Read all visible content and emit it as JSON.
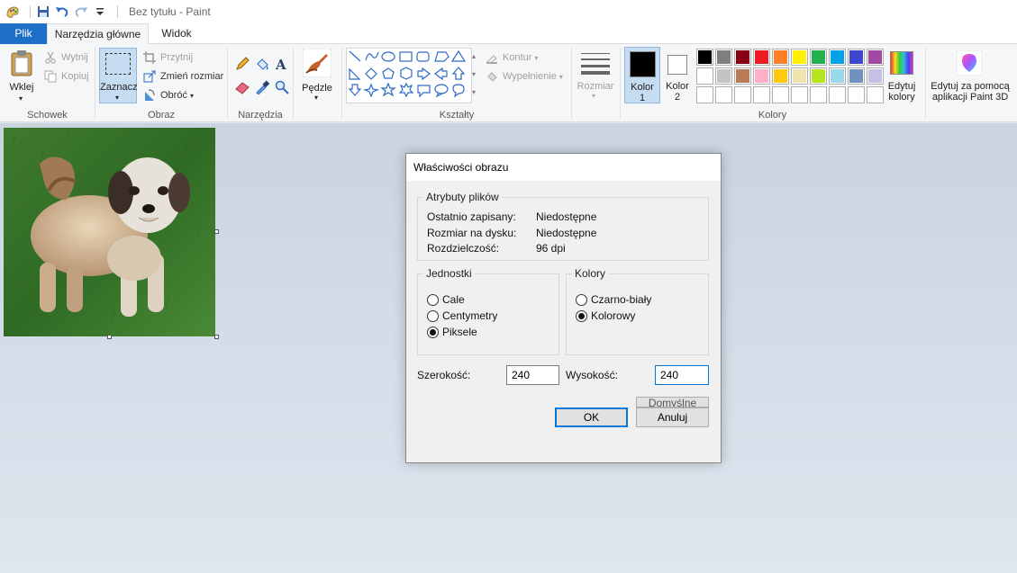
{
  "window": {
    "title": "Bez tytułu - Paint"
  },
  "tabs": {
    "file": "Plik",
    "home": "Narzędzia główne",
    "view": "Widok"
  },
  "clipboard": {
    "paste": "Wklej",
    "cut": "Wytnij",
    "copy": "Kopiuj",
    "group": "Schowek"
  },
  "image": {
    "select": "Zaznacz",
    "crop": "Przytnij",
    "resize": "Zmień rozmiar",
    "rotate": "Obróć",
    "group": "Obraz"
  },
  "tools": {
    "group": "Narzędzia"
  },
  "brushes": {
    "label": "Pędzle"
  },
  "shapes": {
    "outline": "Kontur",
    "fill": "Wypełnienie",
    "group": "Kształty"
  },
  "size": {
    "label": "Rozmiar"
  },
  "colors": {
    "color1": "Kolor",
    "color1_num": "1",
    "color2": "Kolor",
    "color2_num": "2",
    "edit": "Edytuj",
    "edit2": "kolory",
    "group": "Kolory",
    "row1": [
      "#000000",
      "#7f7f7f",
      "#880015",
      "#ed1c24",
      "#ff7f27",
      "#fff200",
      "#22b14c",
      "#00a2e8",
      "#3f48cc",
      "#a349a4"
    ],
    "row2": [
      "#ffffff",
      "#c3c3c3",
      "#b97a57",
      "#ffaec9",
      "#ffc90e",
      "#efe4b0",
      "#b5e61d",
      "#99d9ea",
      "#7092be",
      "#c8bfe7"
    ]
  },
  "paint3d": {
    "line1": "Edytuj za pomocą",
    "line2": "aplikacji Paint 3D"
  },
  "dialog": {
    "title": "Właściwości obrazu",
    "attributes": {
      "legend": "Atrybuty plików",
      "saved_label": "Ostatnio zapisany:",
      "saved_value": "Niedostępne",
      "disk_label": "Rozmiar na dysku:",
      "disk_value": "Niedostępne",
      "res_label": "Rozdzielczość:",
      "res_value": "96 dpi"
    },
    "units": {
      "legend": "Jednostki",
      "inches": "Cale",
      "cm": "Centymetry",
      "pixels": "Piksele",
      "selected": "pixels"
    },
    "colors": {
      "legend": "Kolory",
      "bw": "Czarno-biały",
      "color": "Kolorowy",
      "selected": "color"
    },
    "width_label": "Szerokość:",
    "width_value": "240",
    "height_label": "Wysokość:",
    "height_value": "240",
    "default_btn": "Domyślne",
    "ok": "OK",
    "cancel": "Anuluj"
  }
}
